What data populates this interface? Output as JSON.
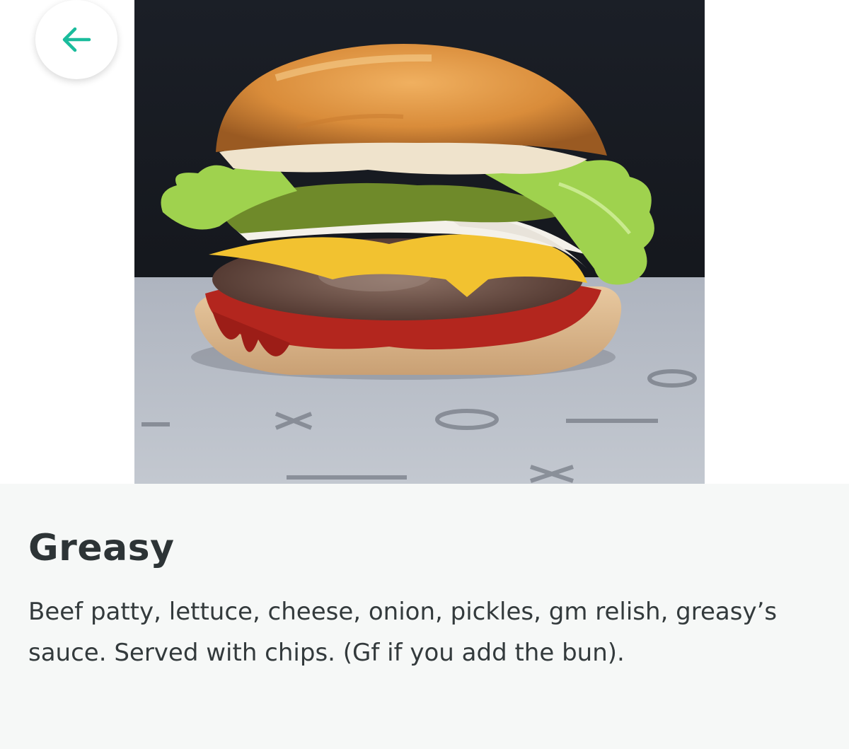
{
  "header": {
    "back_icon": "arrow-left-icon",
    "accent_color": "#1abc9c"
  },
  "item": {
    "image_alt": "Greasy burger with beef patty, cheese, lettuce, onion, pickles and relish",
    "name": "Greasy",
    "description": "Beef patty, lettuce, cheese, onion, pickles, gm relish, greasy’s sauce. Served with chips. (Gf if you add the bun)."
  }
}
